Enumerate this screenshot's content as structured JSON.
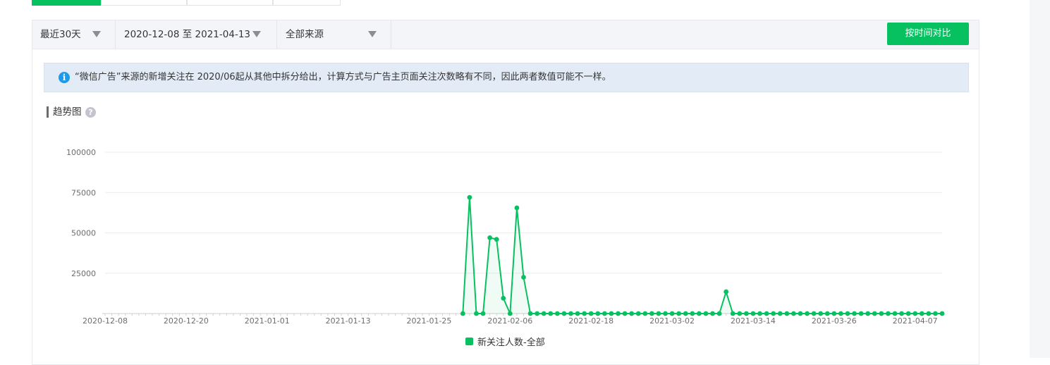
{
  "filters": {
    "range_label": "最近30天",
    "date_range": "2020-12-08 至 2021-04-13",
    "source": "全部来源"
  },
  "compare_button": "按时间对比",
  "notice": "“微信广告”来源的新增关注在 2020/06起从其他中拆分给出，计算方式与广告主页面关注次数略有不同，因此两者数值可能不一样。",
  "section_title": "趋势图",
  "icons": {
    "info": "info-icon",
    "help": "question-icon",
    "dropdown": "caret-down-icon"
  },
  "colors": {
    "accent": "#07c160",
    "notice_bg": "#e3ebf6",
    "info": "#1f9ae8"
  },
  "chart_data": {
    "type": "line",
    "x_start": "2020-12-08",
    "x_end": "2021-04-11",
    "x_ticks": [
      "2020-12-08",
      "2020-12-20",
      "2021-01-01",
      "2021-01-13",
      "2021-01-25",
      "2021-02-06",
      "2021-02-18",
      "2021-03-02",
      "2021-03-14",
      "2021-03-26",
      "2021-04-07"
    ],
    "y_ticks": [
      25000,
      50000,
      75000,
      100000
    ],
    "ylim": [
      0,
      100000
    ],
    "grid": true,
    "legend_position": "bottom-center",
    "series": [
      {
        "name": "新关注人数-全部",
        "color": "#07c160",
        "points": [
          [
            "2021-01-30",
            0
          ],
          [
            "2021-01-31",
            72000
          ],
          [
            "2021-02-01",
            0
          ],
          [
            "2021-02-02",
            0
          ],
          [
            "2021-02-03",
            47000
          ],
          [
            "2021-02-04",
            46000
          ],
          [
            "2021-02-05",
            9500
          ],
          [
            "2021-02-06",
            0
          ],
          [
            "2021-02-07",
            65500
          ],
          [
            "2021-02-08",
            22500
          ],
          [
            "2021-02-09",
            0
          ],
          [
            "2021-02-10",
            0
          ],
          [
            "2021-02-11",
            0
          ],
          [
            "2021-02-12",
            0
          ],
          [
            "2021-02-13",
            0
          ],
          [
            "2021-02-14",
            0
          ],
          [
            "2021-02-15",
            0
          ],
          [
            "2021-02-16",
            0
          ],
          [
            "2021-02-17",
            0
          ],
          [
            "2021-02-18",
            0
          ],
          [
            "2021-02-19",
            0
          ],
          [
            "2021-02-20",
            0
          ],
          [
            "2021-02-21",
            0
          ],
          [
            "2021-02-22",
            0
          ],
          [
            "2021-02-23",
            0
          ],
          [
            "2021-02-24",
            0
          ],
          [
            "2021-02-25",
            0
          ],
          [
            "2021-02-26",
            0
          ],
          [
            "2021-02-27",
            0
          ],
          [
            "2021-02-28",
            0
          ],
          [
            "2021-03-01",
            0
          ],
          [
            "2021-03-02",
            0
          ],
          [
            "2021-03-03",
            0
          ],
          [
            "2021-03-04",
            0
          ],
          [
            "2021-03-05",
            0
          ],
          [
            "2021-03-06",
            0
          ],
          [
            "2021-03-07",
            0
          ],
          [
            "2021-03-08",
            0
          ],
          [
            "2021-03-09",
            0
          ],
          [
            "2021-03-10",
            13500
          ],
          [
            "2021-03-11",
            0
          ],
          [
            "2021-03-12",
            0
          ],
          [
            "2021-03-13",
            0
          ],
          [
            "2021-03-14",
            0
          ],
          [
            "2021-03-15",
            0
          ],
          [
            "2021-03-16",
            0
          ],
          [
            "2021-03-17",
            0
          ],
          [
            "2021-03-18",
            0
          ],
          [
            "2021-03-19",
            0
          ],
          [
            "2021-03-20",
            0
          ],
          [
            "2021-03-21",
            0
          ],
          [
            "2021-03-22",
            0
          ],
          [
            "2021-03-23",
            0
          ],
          [
            "2021-03-24",
            0
          ],
          [
            "2021-03-25",
            0
          ],
          [
            "2021-03-26",
            0
          ],
          [
            "2021-03-27",
            0
          ],
          [
            "2021-03-28",
            0
          ],
          [
            "2021-03-29",
            0
          ],
          [
            "2021-03-30",
            0
          ],
          [
            "2021-03-31",
            0
          ],
          [
            "2021-04-01",
            0
          ],
          [
            "2021-04-02",
            0
          ],
          [
            "2021-04-03",
            0
          ],
          [
            "2021-04-04",
            0
          ],
          [
            "2021-04-05",
            0
          ],
          [
            "2021-04-06",
            0
          ],
          [
            "2021-04-07",
            0
          ],
          [
            "2021-04-08",
            0
          ],
          [
            "2021-04-09",
            0
          ],
          [
            "2021-04-10",
            0
          ],
          [
            "2021-04-11",
            0
          ]
        ]
      }
    ]
  }
}
